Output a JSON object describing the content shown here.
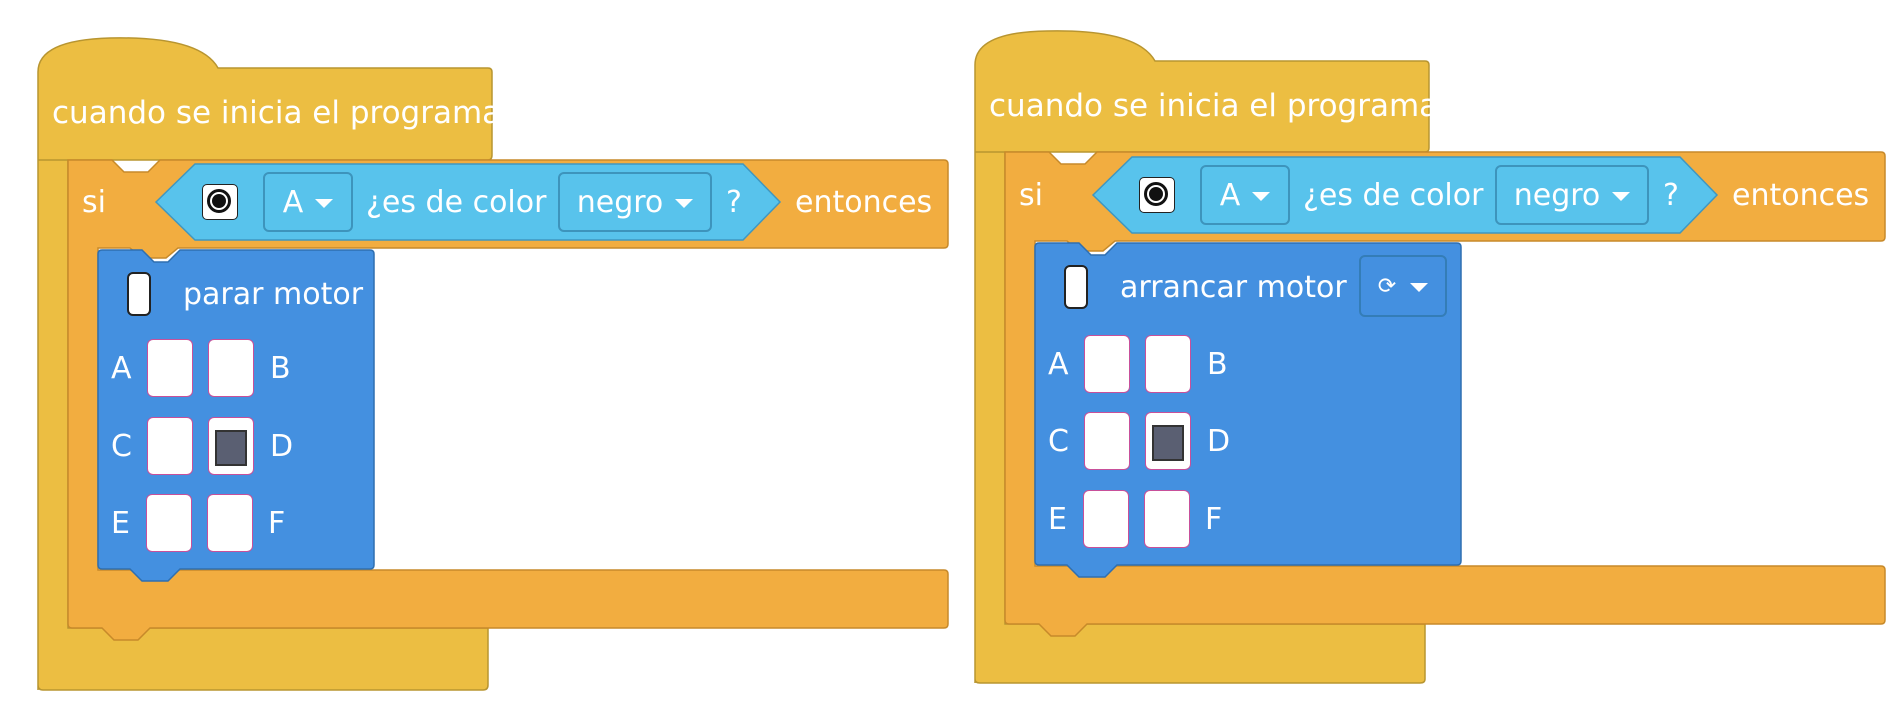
{
  "colors": {
    "hat": "#ECBE42",
    "if_block": "#F2AD40",
    "sensor": "#58C3EC",
    "motor": "#4490E0"
  },
  "programs": [
    {
      "hat_label": "cuando se inicia el programa",
      "if_label": "si",
      "then_label": "entonces",
      "condition": {
        "icon": "color-sensor-icon",
        "port": "A",
        "question": "¿es de color",
        "color": "negro",
        "qmark": "?"
      },
      "motor_block": {
        "icon": "motor-icon",
        "label": "parar motor",
        "has_direction": false,
        "ports": [
          {
            "name": "A",
            "selected": false
          },
          {
            "name": "B",
            "selected": false
          },
          {
            "name": "C",
            "selected": false
          },
          {
            "name": "D",
            "selected": true
          },
          {
            "name": "E",
            "selected": false
          },
          {
            "name": "F",
            "selected": false
          }
        ]
      }
    },
    {
      "hat_label": "cuando se inicia el programa",
      "if_label": "si",
      "then_label": "entonces",
      "condition": {
        "icon": "color-sensor-icon",
        "port": "A",
        "question": "¿es de color",
        "color": "negro",
        "qmark": "?"
      },
      "motor_block": {
        "icon": "motor-icon",
        "label": "arrancar motor",
        "has_direction": true,
        "direction_icon": "clockwise-icon",
        "direction_glyph": "⟳",
        "ports": [
          {
            "name": "A",
            "selected": false
          },
          {
            "name": "B",
            "selected": false
          },
          {
            "name": "C",
            "selected": false
          },
          {
            "name": "D",
            "selected": true
          },
          {
            "name": "E",
            "selected": false
          },
          {
            "name": "F",
            "selected": false
          }
        ]
      }
    }
  ]
}
